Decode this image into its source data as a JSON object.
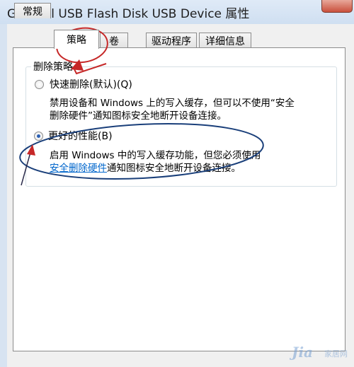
{
  "window": {
    "title": "General USB Flash Disk USB Device 属性"
  },
  "tabs": [
    {
      "label": "常规",
      "selected": false
    },
    {
      "label": "策略",
      "selected": true
    },
    {
      "label": "卷",
      "selected": false
    },
    {
      "label": "驱动程序",
      "selected": false
    },
    {
      "label": "详细信息",
      "selected": false
    }
  ],
  "removal_policy": {
    "group_label": "删除策略",
    "quick_removal": {
      "label": "快速删除(默认)(Q)",
      "desc_line1": "禁用设备和 Windows 上的写入缓存，但可以不使用“安全",
      "desc_line2": "删除硬件”通知图标安全地断开设备连接。",
      "selected": false
    },
    "better_performance": {
      "label": "更好的性能(B)",
      "desc_line1": "启用 Windows 中的写入缓存功能，但您必须使用",
      "link_text": "安全删除硬件",
      "desc_line2_rest": "通知图标安全地断开设备连接。",
      "selected": true
    }
  },
  "watermark": {
    "text": "Jia",
    "sub": "家居网"
  },
  "colors": {
    "annotation": "#c62828",
    "titlebar": "#dfeaf7",
    "link": "#0066cc"
  }
}
